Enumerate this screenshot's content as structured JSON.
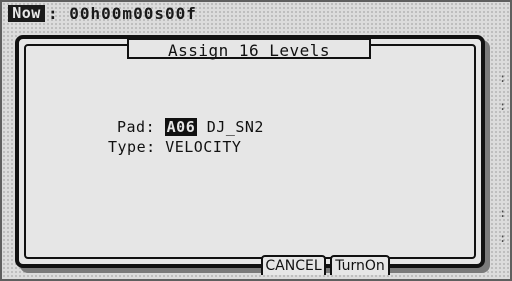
{
  "status": {
    "now_label": "Now",
    "now_value": ": 00h00m00s00f"
  },
  "dialog": {
    "title": "Assign 16 Levels",
    "pad_label": "Pad:",
    "pad_code": "A06",
    "pad_name": "DJ_SN2",
    "type_label": "Type:",
    "type_value": "VELOCITY"
  },
  "softkeys": {
    "cancel": "CANCEL",
    "turn_on": "TurnOn"
  }
}
